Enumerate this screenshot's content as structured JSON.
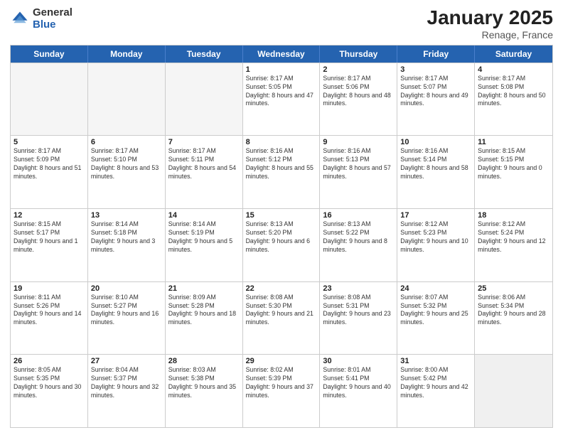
{
  "header": {
    "logo_general": "General",
    "logo_blue": "Blue",
    "month_title": "January 2025",
    "subtitle": "Renage, France"
  },
  "calendar": {
    "days_of_week": [
      "Sunday",
      "Monday",
      "Tuesday",
      "Wednesday",
      "Thursday",
      "Friday",
      "Saturday"
    ],
    "weeks": [
      [
        {
          "day": "",
          "empty": true
        },
        {
          "day": "",
          "empty": true
        },
        {
          "day": "",
          "empty": true
        },
        {
          "day": "1",
          "sunrise": "Sunrise: 8:17 AM",
          "sunset": "Sunset: 5:05 PM",
          "daylight": "Daylight: 8 hours and 47 minutes."
        },
        {
          "day": "2",
          "sunrise": "Sunrise: 8:17 AM",
          "sunset": "Sunset: 5:06 PM",
          "daylight": "Daylight: 8 hours and 48 minutes."
        },
        {
          "day": "3",
          "sunrise": "Sunrise: 8:17 AM",
          "sunset": "Sunset: 5:07 PM",
          "daylight": "Daylight: 8 hours and 49 minutes."
        },
        {
          "day": "4",
          "sunrise": "Sunrise: 8:17 AM",
          "sunset": "Sunset: 5:08 PM",
          "daylight": "Daylight: 8 hours and 50 minutes."
        }
      ],
      [
        {
          "day": "5",
          "sunrise": "Sunrise: 8:17 AM",
          "sunset": "Sunset: 5:09 PM",
          "daylight": "Daylight: 8 hours and 51 minutes."
        },
        {
          "day": "6",
          "sunrise": "Sunrise: 8:17 AM",
          "sunset": "Sunset: 5:10 PM",
          "daylight": "Daylight: 8 hours and 53 minutes."
        },
        {
          "day": "7",
          "sunrise": "Sunrise: 8:17 AM",
          "sunset": "Sunset: 5:11 PM",
          "daylight": "Daylight: 8 hours and 54 minutes."
        },
        {
          "day": "8",
          "sunrise": "Sunrise: 8:16 AM",
          "sunset": "Sunset: 5:12 PM",
          "daylight": "Daylight: 8 hours and 55 minutes."
        },
        {
          "day": "9",
          "sunrise": "Sunrise: 8:16 AM",
          "sunset": "Sunset: 5:13 PM",
          "daylight": "Daylight: 8 hours and 57 minutes."
        },
        {
          "day": "10",
          "sunrise": "Sunrise: 8:16 AM",
          "sunset": "Sunset: 5:14 PM",
          "daylight": "Daylight: 8 hours and 58 minutes."
        },
        {
          "day": "11",
          "sunrise": "Sunrise: 8:15 AM",
          "sunset": "Sunset: 5:15 PM",
          "daylight": "Daylight: 9 hours and 0 minutes."
        }
      ],
      [
        {
          "day": "12",
          "sunrise": "Sunrise: 8:15 AM",
          "sunset": "Sunset: 5:17 PM",
          "daylight": "Daylight: 9 hours and 1 minute."
        },
        {
          "day": "13",
          "sunrise": "Sunrise: 8:14 AM",
          "sunset": "Sunset: 5:18 PM",
          "daylight": "Daylight: 9 hours and 3 minutes."
        },
        {
          "day": "14",
          "sunrise": "Sunrise: 8:14 AM",
          "sunset": "Sunset: 5:19 PM",
          "daylight": "Daylight: 9 hours and 5 minutes."
        },
        {
          "day": "15",
          "sunrise": "Sunrise: 8:13 AM",
          "sunset": "Sunset: 5:20 PM",
          "daylight": "Daylight: 9 hours and 6 minutes."
        },
        {
          "day": "16",
          "sunrise": "Sunrise: 8:13 AM",
          "sunset": "Sunset: 5:22 PM",
          "daylight": "Daylight: 9 hours and 8 minutes."
        },
        {
          "day": "17",
          "sunrise": "Sunrise: 8:12 AM",
          "sunset": "Sunset: 5:23 PM",
          "daylight": "Daylight: 9 hours and 10 minutes."
        },
        {
          "day": "18",
          "sunrise": "Sunrise: 8:12 AM",
          "sunset": "Sunset: 5:24 PM",
          "daylight": "Daylight: 9 hours and 12 minutes."
        }
      ],
      [
        {
          "day": "19",
          "sunrise": "Sunrise: 8:11 AM",
          "sunset": "Sunset: 5:26 PM",
          "daylight": "Daylight: 9 hours and 14 minutes."
        },
        {
          "day": "20",
          "sunrise": "Sunrise: 8:10 AM",
          "sunset": "Sunset: 5:27 PM",
          "daylight": "Daylight: 9 hours and 16 minutes."
        },
        {
          "day": "21",
          "sunrise": "Sunrise: 8:09 AM",
          "sunset": "Sunset: 5:28 PM",
          "daylight": "Daylight: 9 hours and 18 minutes."
        },
        {
          "day": "22",
          "sunrise": "Sunrise: 8:08 AM",
          "sunset": "Sunset: 5:30 PM",
          "daylight": "Daylight: 9 hours and 21 minutes."
        },
        {
          "day": "23",
          "sunrise": "Sunrise: 8:08 AM",
          "sunset": "Sunset: 5:31 PM",
          "daylight": "Daylight: 9 hours and 23 minutes."
        },
        {
          "day": "24",
          "sunrise": "Sunrise: 8:07 AM",
          "sunset": "Sunset: 5:32 PM",
          "daylight": "Daylight: 9 hours and 25 minutes."
        },
        {
          "day": "25",
          "sunrise": "Sunrise: 8:06 AM",
          "sunset": "Sunset: 5:34 PM",
          "daylight": "Daylight: 9 hours and 28 minutes."
        }
      ],
      [
        {
          "day": "26",
          "sunrise": "Sunrise: 8:05 AM",
          "sunset": "Sunset: 5:35 PM",
          "daylight": "Daylight: 9 hours and 30 minutes."
        },
        {
          "day": "27",
          "sunrise": "Sunrise: 8:04 AM",
          "sunset": "Sunset: 5:37 PM",
          "daylight": "Daylight: 9 hours and 32 minutes."
        },
        {
          "day": "28",
          "sunrise": "Sunrise: 8:03 AM",
          "sunset": "Sunset: 5:38 PM",
          "daylight": "Daylight: 9 hours and 35 minutes."
        },
        {
          "day": "29",
          "sunrise": "Sunrise: 8:02 AM",
          "sunset": "Sunset: 5:39 PM",
          "daylight": "Daylight: 9 hours and 37 minutes."
        },
        {
          "day": "30",
          "sunrise": "Sunrise: 8:01 AM",
          "sunset": "Sunset: 5:41 PM",
          "daylight": "Daylight: 9 hours and 40 minutes."
        },
        {
          "day": "31",
          "sunrise": "Sunrise: 8:00 AM",
          "sunset": "Sunset: 5:42 PM",
          "daylight": "Daylight: 9 hours and 42 minutes."
        },
        {
          "day": "",
          "empty": true
        }
      ]
    ]
  }
}
